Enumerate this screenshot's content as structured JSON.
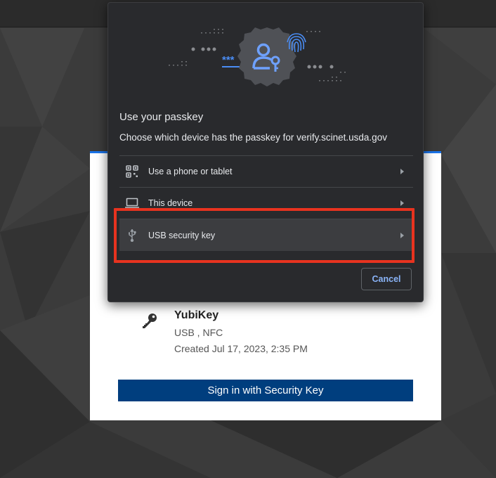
{
  "dialog": {
    "title": "Use your passkey",
    "subtitle": "Choose which device has the passkey for verify.scinet.usda.gov",
    "options": [
      {
        "label": "Use a phone or tablet",
        "icon": "qr-code-icon"
      },
      {
        "label": "This device",
        "icon": "laptop-icon"
      },
      {
        "label": "USB security key",
        "icon": "usb-icon",
        "selected": true
      }
    ],
    "cancel_label": "Cancel"
  },
  "card": {
    "key_name": "YubiKey",
    "transport": "USB , NFC",
    "created": "Created Jul 17, 2023, 2:35 PM",
    "sign_in_label": "Sign in with Security Key"
  },
  "colors": {
    "dialog_bg": "#292a2d",
    "accent_blue": "#8ab4f8",
    "sign_in_button": "#003e7e",
    "highlight": "#e8331f"
  }
}
